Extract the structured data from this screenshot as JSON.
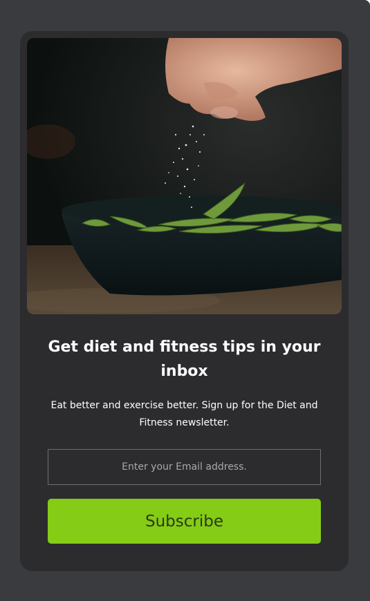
{
  "newsletter": {
    "title": "Get diet and fitness tips in your inbox",
    "description": "Eat better and exercise better. Sign up for the Diet and Fitness newsletter.",
    "email_placeholder": "Enter your Email address.",
    "email_value": "",
    "subscribe_label": "Subscribe"
  },
  "colors": {
    "page_background": "#3a3b3f",
    "card_background": "#2c2c2f",
    "accent": "#84cc16",
    "button_text": "#2d3a12",
    "input_border": "#6e6f73"
  },
  "image": {
    "subject": "hand sprinkling salt onto edamame in a dark bowl"
  }
}
